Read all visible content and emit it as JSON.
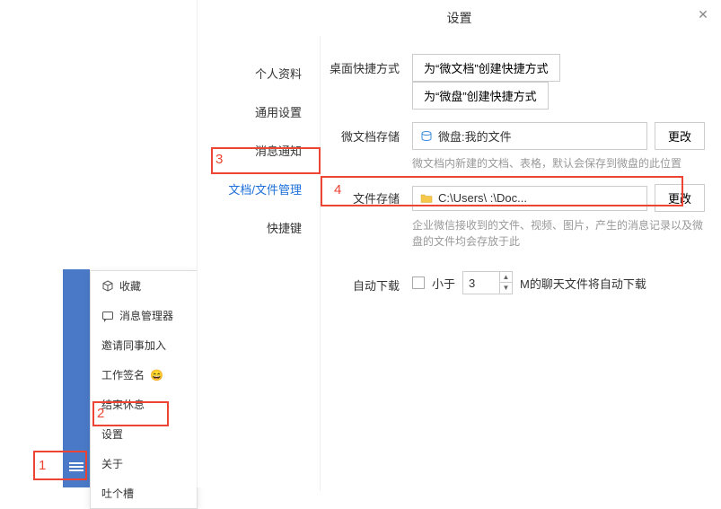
{
  "callouts": {
    "c1": "1",
    "c2": "2",
    "c3": "3",
    "c4": "4"
  },
  "context_menu": {
    "items": [
      {
        "label": "收藏"
      },
      {
        "label": "消息管理器"
      },
      {
        "label": "邀请同事加入"
      },
      {
        "label": "工作签名"
      },
      {
        "label": "结束休息"
      },
      {
        "label": "设置"
      },
      {
        "label": "关于"
      },
      {
        "label": "吐个槽"
      }
    ]
  },
  "dialog": {
    "title": "设置",
    "nav": [
      "个人资料",
      "通用设置",
      "消息通知",
      "文档/文件管理",
      "快捷键"
    ],
    "desktop_shortcut": {
      "label": "桌面快捷方式",
      "btn1": "为“微文档”创建快捷方式",
      "btn2": "为“微盘”创建快捷方式"
    },
    "doc_storage": {
      "label": "微文档存储",
      "path": "微盘:我的文件",
      "change": "更改",
      "hint": "微文档内新建的文档、表格，默认会保存到微盘的此位置"
    },
    "file_storage": {
      "label": "文件存储",
      "path": "C:\\Users\\              :\\Doc...",
      "change": "更改",
      "hint": "企业微信接收到的文件、视频、图片，产生的消息记录以及微盘的文件均会存放于此"
    },
    "auto_download": {
      "label": "自动下载",
      "prefix": "小于",
      "value": "3",
      "suffix": "M的聊天文件将自动下载"
    }
  }
}
